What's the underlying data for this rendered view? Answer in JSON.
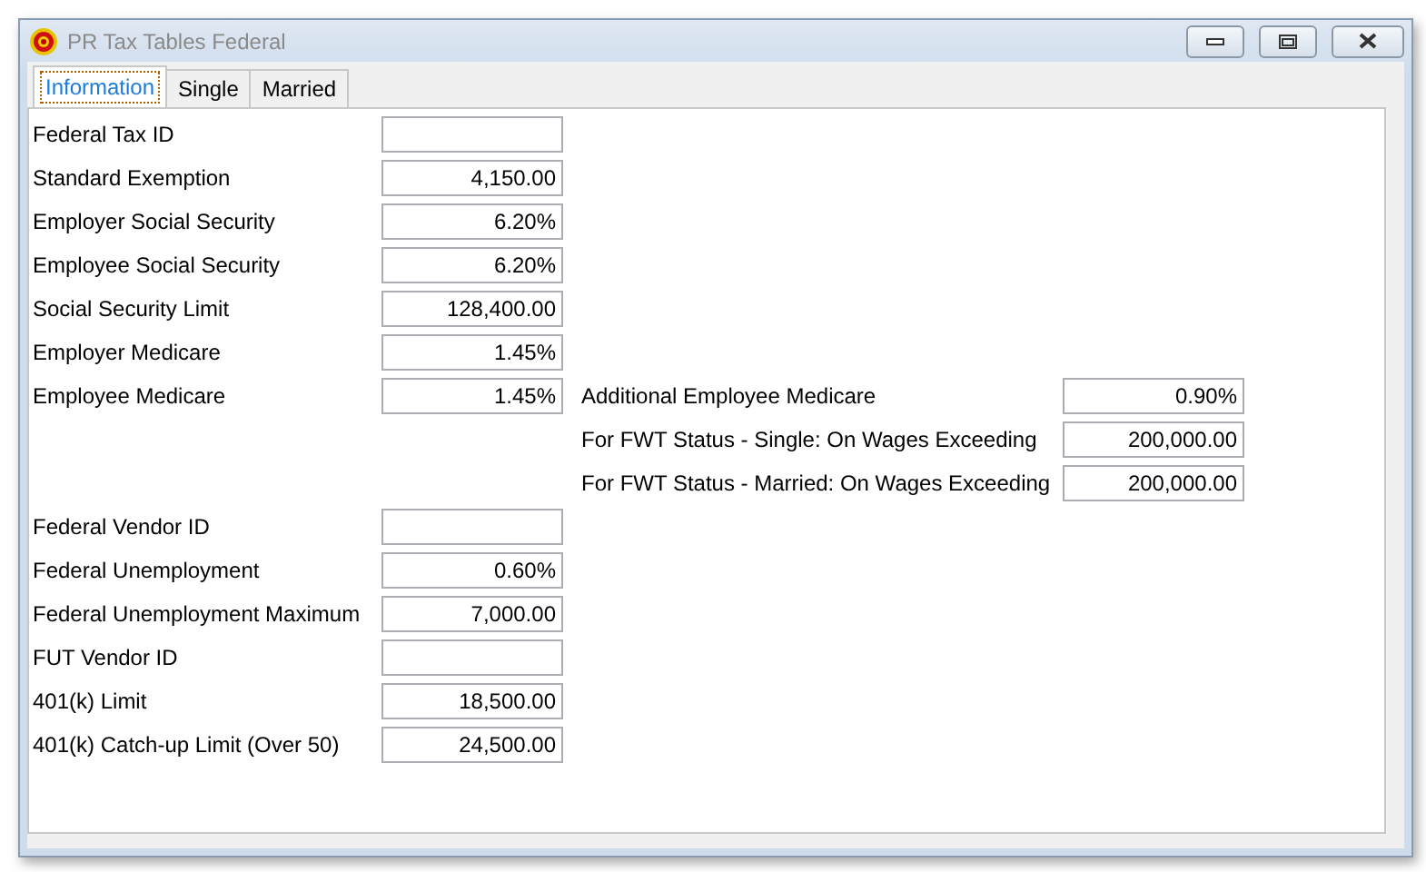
{
  "window": {
    "title": "PR Tax Tables Federal",
    "active": false
  },
  "tabs": [
    {
      "label": "Information",
      "selected": true
    },
    {
      "label": "Single",
      "selected": false
    },
    {
      "label": "Married",
      "selected": false
    }
  ],
  "rows": [
    {
      "left": {
        "label": "Federal Tax ID"
      }
    },
    {
      "left": {
        "label": "Standard Exemption",
        "value": "4,150.00"
      }
    },
    {
      "left": {
        "label": "Employer Social Security",
        "value": "6.20%"
      }
    },
    {
      "left": {
        "label": "Employee Social Security",
        "value": "6.20%"
      }
    },
    {
      "left": {
        "label": "Social Security Limit",
        "value": "128,400.00"
      }
    },
    {
      "left": {
        "label": "Employer Medicare",
        "value": "1.45%"
      }
    },
    {
      "left": {
        "label": "Employee Medicare",
        "value": "1.45%"
      },
      "right": {
        "label": "Additional Employee Medicare",
        "value": "0.90%"
      }
    },
    {
      "right": {
        "label": "For FWT Status - Single: On Wages Exceeding",
        "value": "200,000.00"
      }
    },
    {
      "right": {
        "label": "For FWT Status - Married: On Wages Exceeding",
        "value": "200,000.00"
      }
    },
    {
      "left": {
        "label": "Federal Vendor ID"
      }
    },
    {
      "left": {
        "label": "Federal Unemployment",
        "value": "0.60%"
      }
    },
    {
      "left": {
        "label": "Federal Unemployment Maximum",
        "value": "7,000.00"
      }
    },
    {
      "left": {
        "label": "FUT Vendor ID"
      }
    },
    {
      "left": {
        "label": "401(k) Limit",
        "value": "18,500.00"
      }
    },
    {
      "left": {
        "label": "401(k) Catch-up Limit (Over 50)",
        "value": "24,500.00"
      }
    }
  ]
}
